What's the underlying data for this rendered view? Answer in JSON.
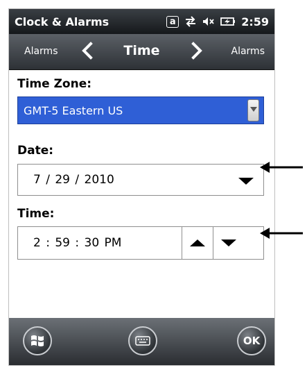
{
  "status_bar": {
    "title": "Clock & Alarms",
    "input_mode": "a",
    "time": "2:59"
  },
  "nav": {
    "prev_label": "Alarms",
    "title": "Time",
    "next_label": "Alarms"
  },
  "timezone": {
    "label": "Time Zone:",
    "value": "GMT-5 Eastern US"
  },
  "date": {
    "label": "Date:",
    "value": "7  /  29  / 2010"
  },
  "time": {
    "label": "Time:",
    "value": "2  :  59  :  30    PM"
  },
  "softkeys": {
    "ok_label": "OK"
  },
  "colors": {
    "selection": "#2f5fd6",
    "bar_dark": "#15181b"
  }
}
